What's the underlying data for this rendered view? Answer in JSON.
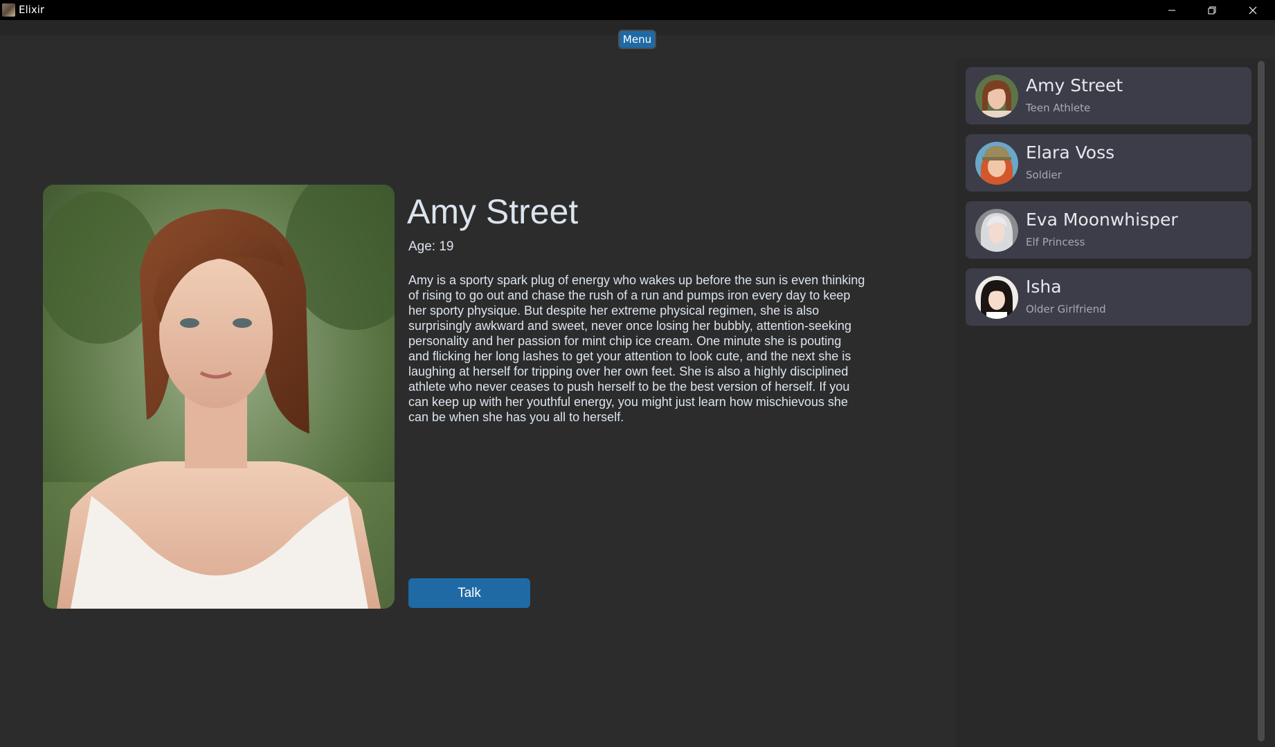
{
  "window": {
    "title": "Elixir"
  },
  "header": {
    "menu_label": "Menu"
  },
  "profile": {
    "name": "Amy Street",
    "age": "Age: 19",
    "description": "Amy is a sporty spark plug of energy who wakes up before the sun is even thinking of rising to go out and chase the rush of a run and pumps iron every day to keep her sporty physique. But despite her extreme physical regimen, she is also surprisingly awkward and sweet, never once losing her bubbly, attention-seeking personality and her passion for mint chip ice cream. One minute she is pouting and flicking her long lashes to get your attention to look cute, and the next she is laughing at herself for tripping over her own feet. She is also a highly disciplined athlete who never ceases to push herself to be the best version of herself. If you can keep up with her youthful energy, you might just learn how mischievous she can be when she has you all to herself.",
    "talk_label": "Talk"
  },
  "characters": [
    {
      "name": "Amy Street",
      "role": "Teen Athlete"
    },
    {
      "name": "Elara Voss",
      "role": "Soldier"
    },
    {
      "name": "Eva Moonwhisper",
      "role": "Elf Princess"
    },
    {
      "name": "Isha",
      "role": "Older Girlfriend"
    }
  ],
  "colors": {
    "accent": "#1f6aa5",
    "background": "#2c2c2c",
    "card": "#3c3d48"
  }
}
